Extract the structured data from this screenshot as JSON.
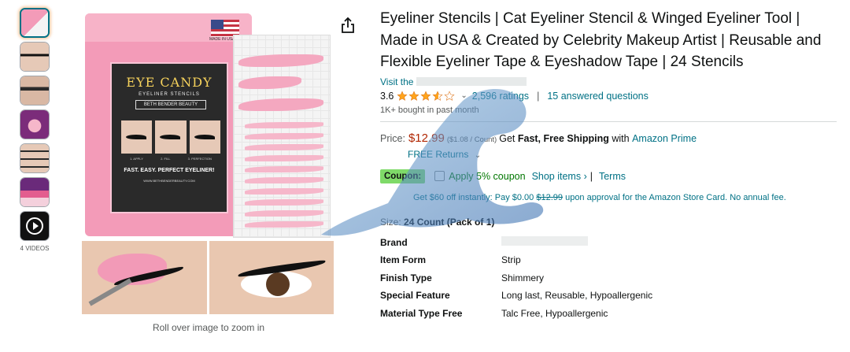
{
  "gallery": {
    "thumbnails": [
      {
        "name": "thumb-1"
      },
      {
        "name": "thumb-2"
      },
      {
        "name": "thumb-3"
      },
      {
        "name": "thumb-4"
      },
      {
        "name": "thumb-5"
      },
      {
        "name": "thumb-6"
      }
    ],
    "videos_label": "4 VIDEOS",
    "roll_over_caption": "Roll over image to zoom in",
    "product_image": {
      "flag_text": "MADE IN USA",
      "brand_title": "EYE CANDY",
      "brand_subtitle": "EYELINER STENCILS",
      "brand_box": "BETH BENDER BEAUTY",
      "steps": [
        "1. APPLY",
        "2. FILL",
        "3. PERFECTION"
      ],
      "tagline": "FAST. EASY. PERFECT EYELINER!",
      "site": "WWW.BETHBENDERBEAUTY.COM"
    }
  },
  "product": {
    "title": "Eyeliner Stencils | Cat Eyeliner Stencil & Winged Eyeliner Tool | Made in USA & Created by Celebrity Makeup Artist | Reusable and Flexible Eyeliner Tape & Eyeshadow Tape | 24 Stencils",
    "visit_store_prefix": "Visit the",
    "rating": "3.6",
    "rating_value": 3.6,
    "ratings_count": "2,596 ratings",
    "answered_questions": "15 answered questions",
    "bought": "1K+ bought in past month"
  },
  "pricing": {
    "label": "Price:",
    "price": "$12.99",
    "unit_price": "($1.08 / Count)",
    "shipping_prefix": "Get",
    "shipping_bold": "Fast, Free Shipping",
    "shipping_with": "with",
    "prime": "Amazon Prime",
    "free_returns": "FREE Returns",
    "coupon_badge": "Coupon:",
    "coupon_text": "Apply 5% coupon",
    "shop_items": "Shop items ›",
    "terms_sep": "|",
    "terms": "Terms",
    "card_offer_prefix": "Get $60 off instantly: Pay $0.00",
    "card_offer_strike": "$12.99",
    "card_offer_suffix": "upon approval for the Amazon Store Card. No annual fee."
  },
  "size": {
    "label": "Size:",
    "value": "24 Count (Pack of 1)"
  },
  "specs": [
    {
      "key": "Brand",
      "value": ""
    },
    {
      "key": "Item Form",
      "value": "Strip"
    },
    {
      "key": "Finish Type",
      "value": "Shimmery"
    },
    {
      "key": "Special Feature",
      "value": "Long last, Reusable, Hypoallergenic"
    },
    {
      "key": "Material Type Free",
      "value": "Talc Free, Hypoallergenic"
    }
  ],
  "colors": {
    "link": "#007185",
    "price": "#b12704",
    "coupon_badge": "#7fda69",
    "coupon_text": "#007600",
    "star": "#ffa41c",
    "pouch_pink": "#f39bb8"
  }
}
